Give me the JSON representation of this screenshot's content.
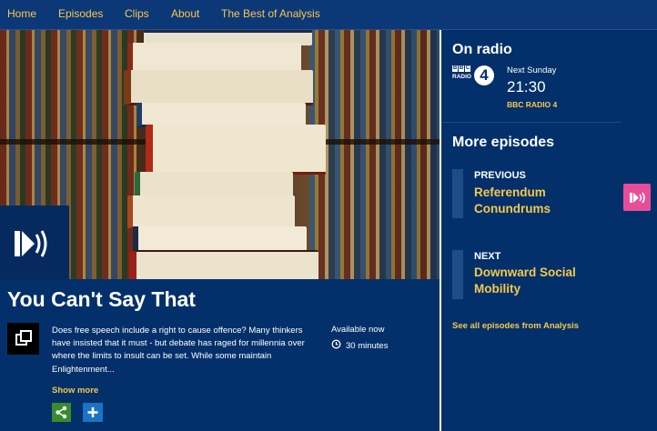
{
  "nav": {
    "items": [
      "Home",
      "Episodes",
      "Clips",
      "About",
      "The Best of Analysis"
    ]
  },
  "episode": {
    "title": "You Can't Say That",
    "description": "Does free speech include a right to cause offence? Many thinkers have insisted that it must - but debate has raged for millennia over where the limits to insult can be set. While some maintain Enlightenment...",
    "availability": "Available now",
    "duration": "30 minutes",
    "show_more": "Show more"
  },
  "on_radio": {
    "heading": "On radio",
    "station_logo_text": [
      "BBC",
      "RADIO",
      "4"
    ],
    "day": "Next Sunday",
    "time": "21:30",
    "station": "BBC RADIO 4"
  },
  "more_episodes": {
    "heading": "More episodes",
    "previous": {
      "kind": "PREVIOUS",
      "title": "Referendum Conundrums"
    },
    "next": {
      "kind": "NEXT",
      "title": "Downward Social Mobility"
    },
    "see_all": "See all episodes from Analysis"
  },
  "colors": {
    "background": "#03306a",
    "accent": "#f5c84c",
    "share": "#3a8b2f",
    "add": "#1a73c6",
    "pink": "#e84d9a"
  }
}
